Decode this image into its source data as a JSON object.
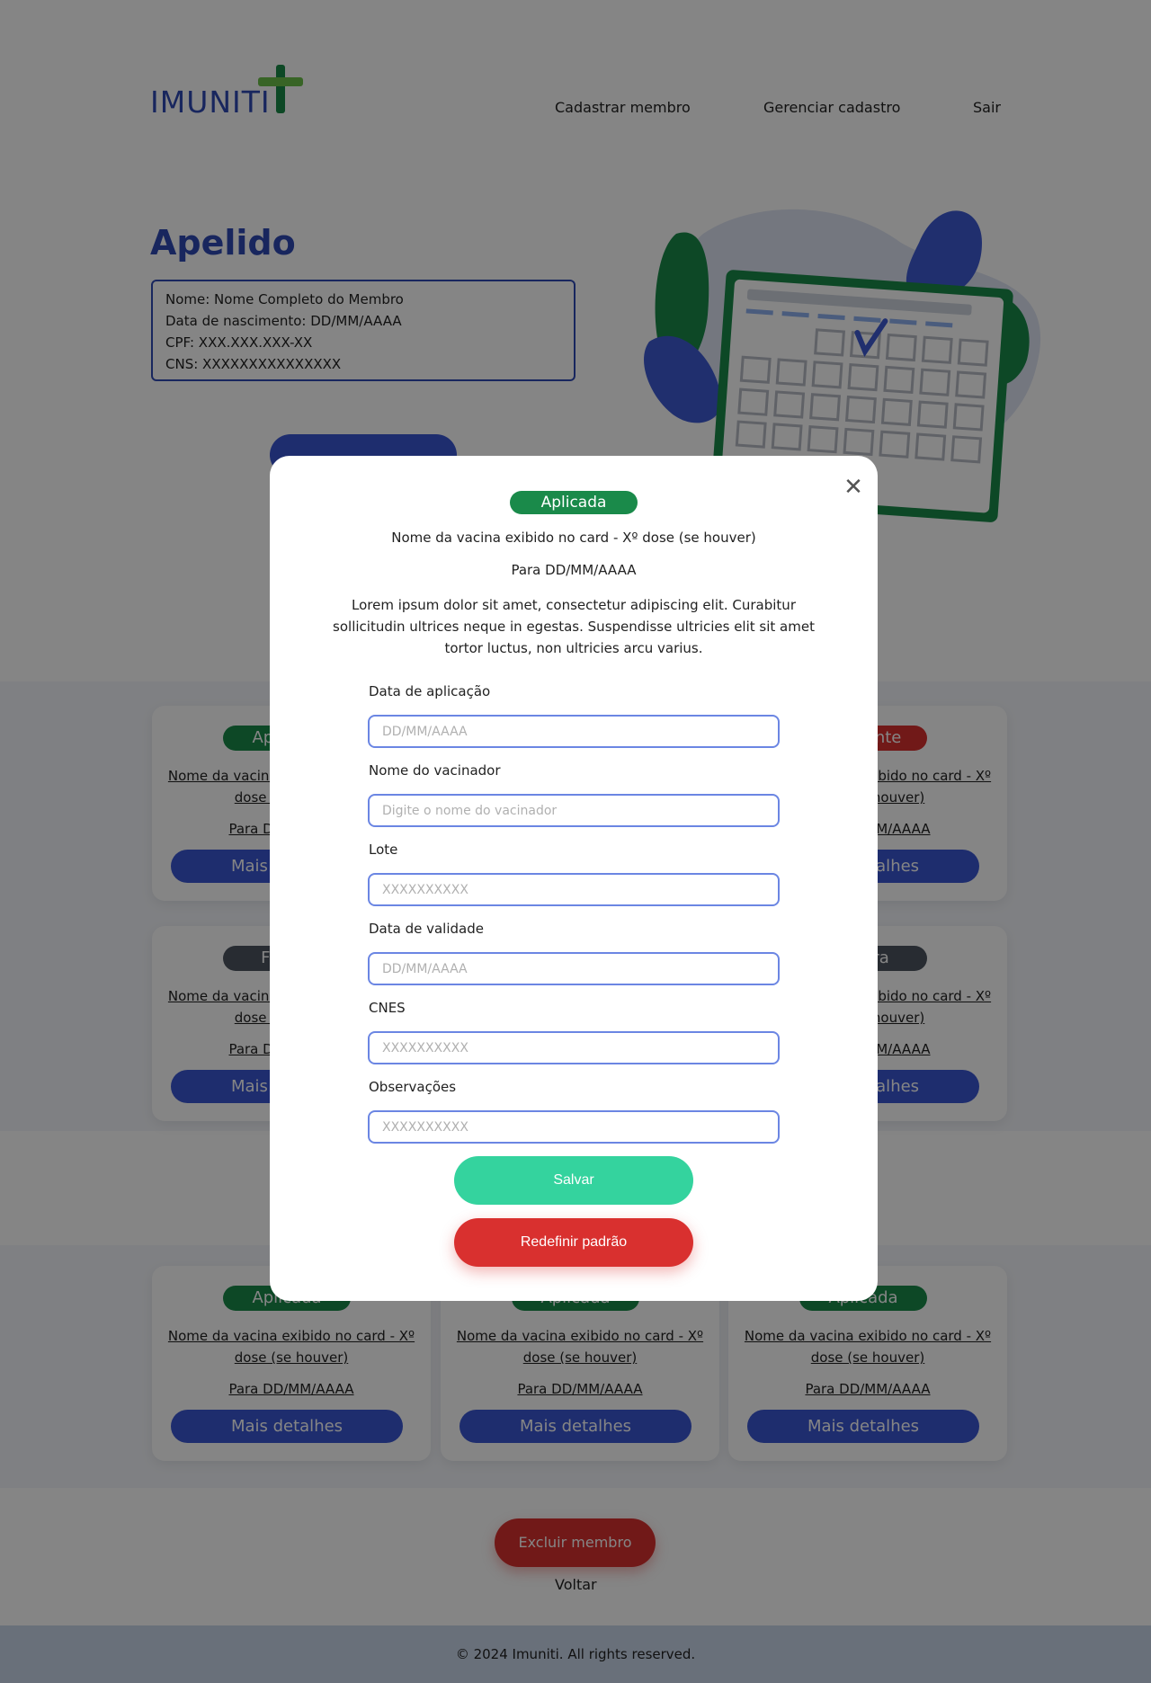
{
  "header": {
    "logo_text": "IMUNITI",
    "nav": [
      "Cadastrar membro",
      "Gerenciar cadastro",
      "Sair"
    ]
  },
  "member": {
    "nickname": "Apelido",
    "name_line": "Nome: Nome Completo do Membro",
    "birth_line": "Data de nascimento: DD/MM/AAAA",
    "cpf_line": "CPF: XXX.XXX.XXX-XX",
    "cns_line": "CNS: XXXXXXXXXXXXXXX"
  },
  "cards_row1": [
    {
      "status": "Aplicada",
      "status_color": "#1a8a4a",
      "name": "Nome da vacina exibido no card - Xº dose (se houver)",
      "date": "Para DD/MM/AAAA",
      "button": "Mais detalhes"
    },
    {
      "status": "Pendente",
      "status_color": "#d9302f",
      "name": "Nome da vacina exibido no card - Xº dose (se houver)",
      "date": "Para DD/MM/AAAA",
      "button": "Mais detalhes"
    }
  ],
  "cards_row2": [
    {
      "status": "Futura",
      "status_color": "#4d5560",
      "name": "Nome da vacina exibido no card - Xº dose (se houver)",
      "date": "Para DD/MM/AAAA",
      "button": "Mais detalhes"
    },
    {
      "status": "Futura",
      "status_color": "#4d5560",
      "name": "Nome da vacina exibido no card - Xº dose (se houver)",
      "date": "Para DD/MM/AAAA",
      "button": "Mais detalhes"
    }
  ],
  "cards_row3": [
    {
      "status": "Aplicada",
      "status_color": "#1a8a4a",
      "name": "Nome da vacina exibido no card - Xº dose (se houver)",
      "date": "Para DD/MM/AAAA",
      "button": "Mais detalhes"
    },
    {
      "status": "Aplicada",
      "status_color": "#1a8a4a",
      "name": "Nome da vacina exibido no card - Xº dose (se houver)",
      "date": "Para DD/MM/AAAA",
      "button": "Mais detalhes"
    },
    {
      "status": "Aplicada",
      "status_color": "#1a8a4a",
      "name": "Nome da vacina exibido no card - Xº dose (se houver)",
      "date": "Para DD/MM/AAAA",
      "button": "Mais detalhes"
    }
  ],
  "actions": {
    "delete_label": "Excluir membro",
    "back_label": "Voltar"
  },
  "footer": {
    "text": "© 2024 Imuniti. All rights reserved."
  },
  "modal": {
    "close_icon": "close-icon",
    "status": "Aplicada",
    "status_color": "#1a8a4a",
    "vaccine_title": "Nome da vacina exibido no card - Xº dose (se houver)",
    "due_date": "Para DD/MM/AAAA",
    "description": "Lorem ipsum dolor sit amet, consectetur adipiscing elit. Curabitur sollicitudin ultrices neque in egestas. Suspendisse ultricies elit sit amet tortor luctus, non ultricies arcu varius.",
    "fields": [
      {
        "label": "Data de aplicação",
        "placeholder": "DD/MM/AAAA",
        "value": ""
      },
      {
        "label": "Nome do vacinador",
        "placeholder": "Digite o nome do vacinador",
        "value": ""
      },
      {
        "label": "Lote",
        "placeholder": "XXXXXXXXXX",
        "value": ""
      },
      {
        "label": "Data de validade",
        "placeholder": "DD/MM/AAAA",
        "value": ""
      },
      {
        "label": "CNES",
        "placeholder": "XXXXXXXXXX",
        "value": ""
      },
      {
        "label": "Observações",
        "placeholder": "XXXXXXXXXX",
        "value": ""
      }
    ],
    "save_label": "Salvar",
    "reset_label": "Redefinir padrão"
  },
  "colors": {
    "primary": "#3a56d4",
    "brand_blue": "#2f49b5",
    "success": "#34d39e",
    "danger": "#d9302f"
  }
}
